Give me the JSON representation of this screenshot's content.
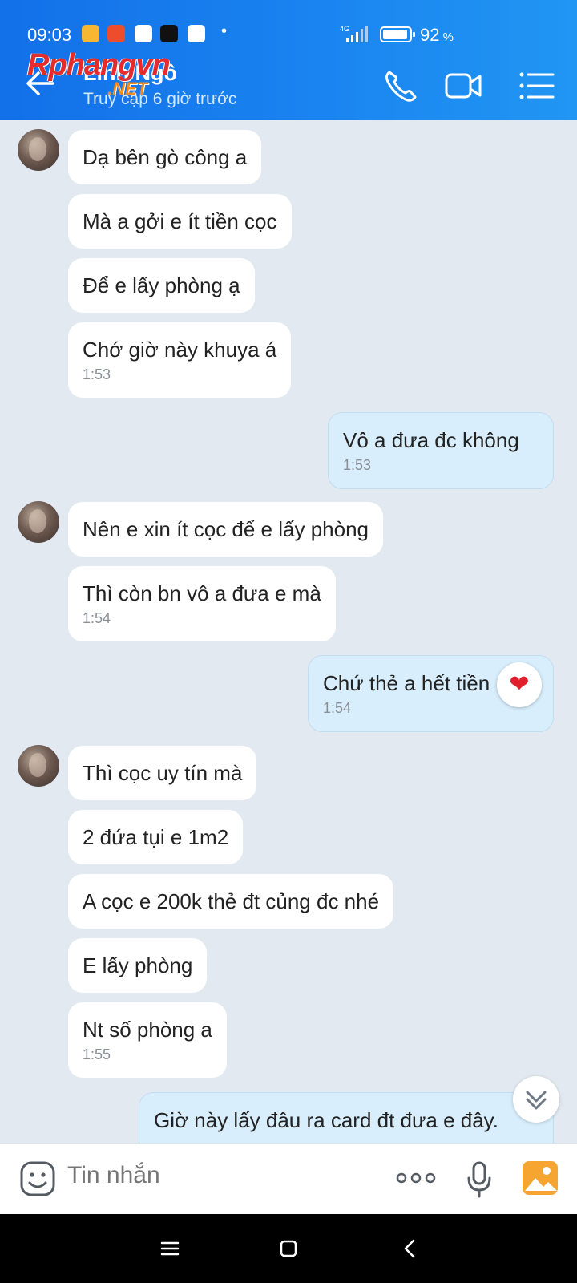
{
  "status": {
    "time": "09:03",
    "net": "4G",
    "battery": "92",
    "battery_unit": "%"
  },
  "header": {
    "contact_name": "Linh Ngô",
    "last_seen": "Truy cập 6 giờ trước",
    "watermark_main": "Rphangvn",
    "watermark_sub": ".NET"
  },
  "messages": [
    {
      "text": "Dạ bên gò công a"
    },
    {
      "text": "Mà a gởi e ít tiền cọc"
    },
    {
      "text": "Để e lấy phòng ạ"
    },
    {
      "text": "Chớ giờ này khuya á",
      "time": "1:53"
    },
    {
      "text": "Vô a đưa đc không",
      "time": "1:53"
    },
    {
      "text": "Nên e xin ít cọc để e lấy phòng"
    },
    {
      "text": "Thì còn bn vô a đưa e mà",
      "time": "1:54"
    },
    {
      "text": "Chứ thẻ a hết tiền",
      "time": "1:54"
    },
    {
      "text": "Thì cọc uy tín mà"
    },
    {
      "text": "2 đứa tụi e 1m2"
    },
    {
      "text": "A cọc e 200k thẻ đt củng đc nhé"
    },
    {
      "text": "E lấy phòng"
    },
    {
      "text": "Nt số phòng a",
      "time": "1:55"
    },
    {
      "text": "Giờ này lấy đâu ra card đt đưa e đây."
    }
  ],
  "reaction": "❤",
  "input": {
    "placeholder": "Tin nhắn"
  },
  "icons": [
    "back-arrow-icon",
    "phone-icon",
    "video-call-icon",
    "menu-list-icon",
    "sticker-icon",
    "more-icon",
    "microphone-icon",
    "image-icon",
    "chevron-double-down-icon"
  ]
}
